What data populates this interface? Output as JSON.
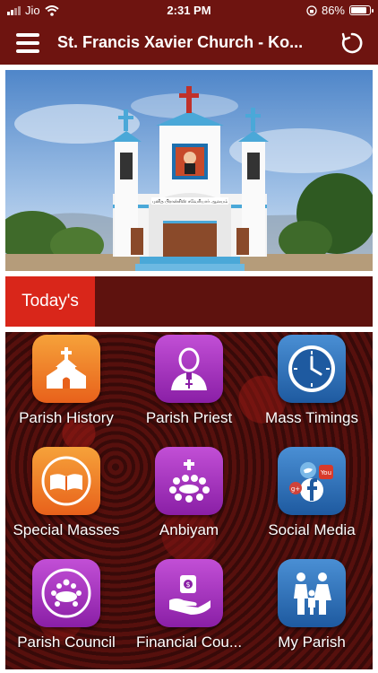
{
  "status_bar": {
    "carrier": "Jio",
    "time": "2:31 PM",
    "battery_text": "86%",
    "battery_level": 0.86
  },
  "app_bar": {
    "title": "St. Francis Xavier Church - Ko..."
  },
  "hero": {
    "church_sign_text": "புனித பிரான்சிஸ் சவேரியார் ஆலயம்"
  },
  "today": {
    "tab_label": "Today's"
  },
  "menu": [
    {
      "label": "Parish History",
      "icon": "church-icon",
      "color": "orange"
    },
    {
      "label": "Parish Priest",
      "icon": "priest-icon",
      "color": "purple"
    },
    {
      "label": "Mass Timings",
      "icon": "clock-icon",
      "color": "blue"
    },
    {
      "label": "Special Masses",
      "icon": "bible-icon",
      "color": "orange"
    },
    {
      "label": "Anbiyam",
      "icon": "community-icon",
      "color": "purple"
    },
    {
      "label": "Social Media",
      "icon": "social-media-icon",
      "color": "blue"
    },
    {
      "label": "Parish Council",
      "icon": "council-icon",
      "color": "purple"
    },
    {
      "label": "Financial Cou...",
      "icon": "donation-icon",
      "color": "purple"
    },
    {
      "label": "My Parish",
      "icon": "family-icon",
      "color": "blue"
    }
  ],
  "colors": {
    "header": "#6e1410",
    "today_tab": "#d9261a",
    "orange_tile": "#e8611b",
    "purple_tile": "#8a1fa6",
    "blue_tile": "#1e5aa0"
  }
}
